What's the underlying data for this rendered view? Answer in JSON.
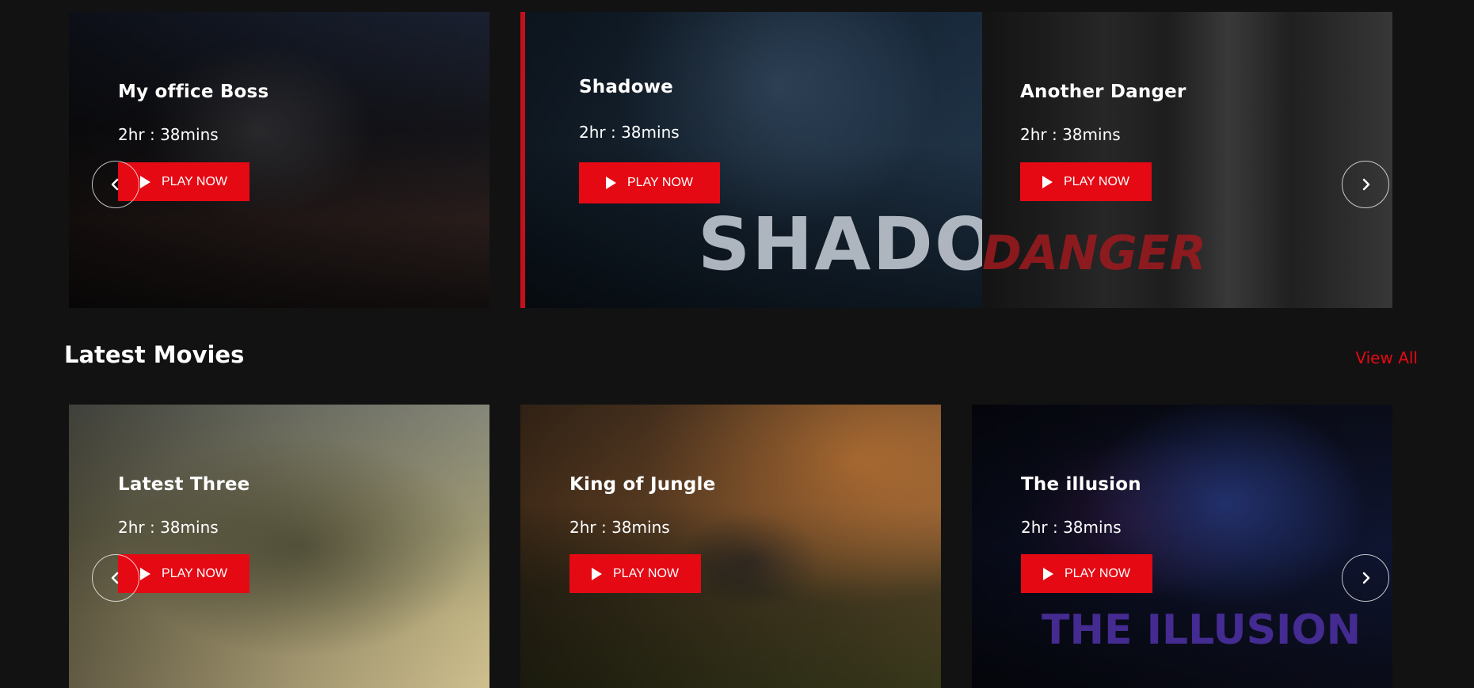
{
  "accent_color": "#e50914",
  "featured": {
    "cards": [
      {
        "title": "My office Boss",
        "duration": "2hr : 38mins",
        "play_label": "PLAY NOW"
      },
      {
        "title": "Shadowe",
        "duration": "2hr : 38mins",
        "play_label": "PLAY NOW",
        "poster_text": "SHADOW"
      },
      {
        "title": "Another Danger",
        "duration": "2hr : 38mins",
        "play_label": "PLAY NOW",
        "poster_text": "DANGER"
      }
    ]
  },
  "latest": {
    "heading": "Latest Movies",
    "view_all": "View All",
    "cards": [
      {
        "title": "Latest Three",
        "duration": "2hr : 38mins",
        "play_label": "PLAY NOW"
      },
      {
        "title": "King of Jungle",
        "duration": "2hr : 38mins",
        "play_label": "PLAY NOW"
      },
      {
        "title": "The illusion",
        "duration": "2hr : 38mins",
        "play_label": "PLAY NOW",
        "poster_text": "THE ILLUSION"
      }
    ]
  },
  "icons": {
    "prev": "chevron-left-icon",
    "next": "chevron-right-icon",
    "play": "play-icon"
  }
}
